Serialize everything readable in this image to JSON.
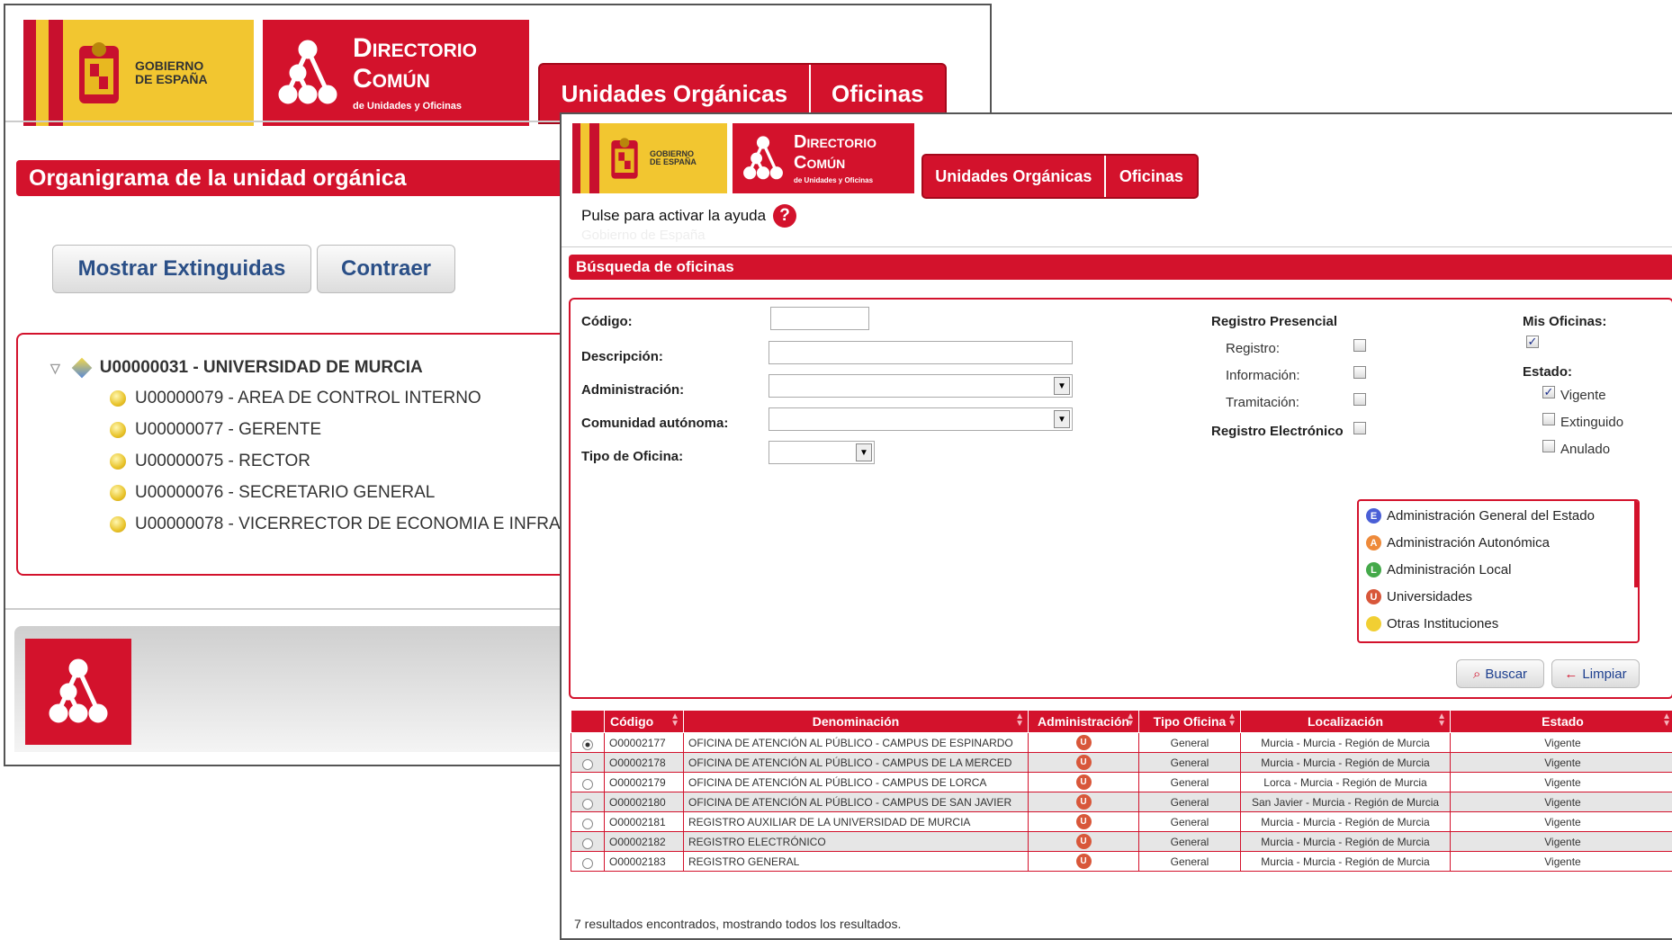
{
  "win1": {
    "gobierno_text": [
      "GOBIERNO",
      "DE ESPAÑA"
    ],
    "dc_title": [
      "Directorio",
      "Común"
    ],
    "dc_subtitle": "de Unidades y Oficinas",
    "nav": [
      "Unidades Orgánicas",
      "Oficinas"
    ],
    "section_title": "Organigrama de la unidad orgánica",
    "buttons": [
      "Mostrar Extinguidas",
      "Contraer"
    ],
    "tree_root": "U00000031 - UNIVERSIDAD DE MURCIA",
    "tree_children": [
      "U00000079 - AREA DE CONTROL INTERNO",
      "U00000077 - GERENTE",
      "U00000075 - RECTOR",
      "U00000076 - SECRETARIO GENERAL",
      "U00000078 - VICERRECTOR DE ECONOMIA E INFRA"
    ]
  },
  "win2": {
    "gobierno_text": [
      "GOBIERNO",
      "DE ESPAÑA"
    ],
    "dc_title": [
      "Directorio",
      "Común"
    ],
    "dc_subtitle": "de Unidades y Oficinas",
    "nav": [
      "Unidades Orgánicas",
      "Oficinas"
    ],
    "help_text": "Pulse para activar la ayuda",
    "faded_text": "Gobierno de España",
    "section_title": "Búsqueda de oficinas",
    "fields": {
      "codigo": "Código:",
      "descripcion": "Descripción:",
      "administracion": "Administración:",
      "comunidad": "Comunidad autónoma:",
      "tipo": "Tipo de Oficina:"
    },
    "registro_presencial": "Registro Presencial",
    "registro_opts": [
      "Registro:",
      "Información:",
      "Tramitación:"
    ],
    "registro_electronico": "Registro Electrónico",
    "mis_oficinas": "Mis Oficinas:",
    "estado": "Estado:",
    "estado_opts": [
      {
        "label": "Vigente",
        "checked": true
      },
      {
        "label": "Extinguido",
        "checked": false
      },
      {
        "label": "Anulado",
        "checked": false
      }
    ],
    "legend": [
      {
        "letter": "E",
        "label": "Administración General del Estado",
        "color": "#4a5fd6"
      },
      {
        "letter": "A",
        "label": "Administración Autonómica",
        "color": "#ee8a3a"
      },
      {
        "letter": "L",
        "label": "Administración Local",
        "color": "#44a94a"
      },
      {
        "letter": "U",
        "label": "Universidades",
        "color": "#d8573a"
      },
      {
        "letter": "",
        "label": "Otras Instituciones",
        "color": "#f1cf33"
      }
    ],
    "buscar": "Buscar",
    "limpiar": "Limpiar",
    "table_headers": [
      "Código",
      "Denominación",
      "Administración",
      "Tipo Oficina",
      "Localización",
      "Estado"
    ],
    "rows": [
      {
        "codigo": "O00002177",
        "denom": "OFICINA DE ATENCIÓN AL PÚBLICO - CAMPUS DE ESPINARDO",
        "adm": "U",
        "tipo": "General",
        "loc": "Murcia - Murcia - Región de Murcia",
        "estado": "Vigente"
      },
      {
        "codigo": "O00002178",
        "denom": "OFICINA DE ATENCIÓN AL PÚBLICO - CAMPUS DE LA MERCED",
        "adm": "U",
        "tipo": "General",
        "loc": "Murcia - Murcia - Región de Murcia",
        "estado": "Vigente"
      },
      {
        "codigo": "O00002179",
        "denom": "OFICINA DE ATENCIÓN AL PÚBLICO - CAMPUS DE LORCA",
        "adm": "U",
        "tipo": "General",
        "loc": "Lorca - Murcia - Región de Murcia",
        "estado": "Vigente"
      },
      {
        "codigo": "O00002180",
        "denom": "OFICINA DE ATENCIÓN AL PÚBLICO - CAMPUS DE SAN JAVIER",
        "adm": "U",
        "tipo": "General",
        "loc": "San Javier - Murcia - Región de Murcia",
        "estado": "Vigente"
      },
      {
        "codigo": "O00002181",
        "denom": "REGISTRO AUXILIAR DE LA UNIVERSIDAD DE MURCIA",
        "adm": "U",
        "tipo": "General",
        "loc": "Murcia - Murcia - Región de Murcia",
        "estado": "Vigente"
      },
      {
        "codigo": "O00002182",
        "denom": "REGISTRO ELECTRÓNICO",
        "adm": "U",
        "tipo": "General",
        "loc": "Murcia - Murcia - Región de Murcia",
        "estado": "Vigente"
      },
      {
        "codigo": "O00002183",
        "denom": "REGISTRO GENERAL",
        "adm": "U",
        "tipo": "General",
        "loc": "Murcia - Murcia - Región de Murcia",
        "estado": "Vigente"
      }
    ],
    "results_text": "7 resultados encontrados, mostrando todos los resultados."
  },
  "colors": {
    "brand_red": "#d3122c",
    "gold": "#f2c630",
    "link_blue": "#2a4f87"
  }
}
